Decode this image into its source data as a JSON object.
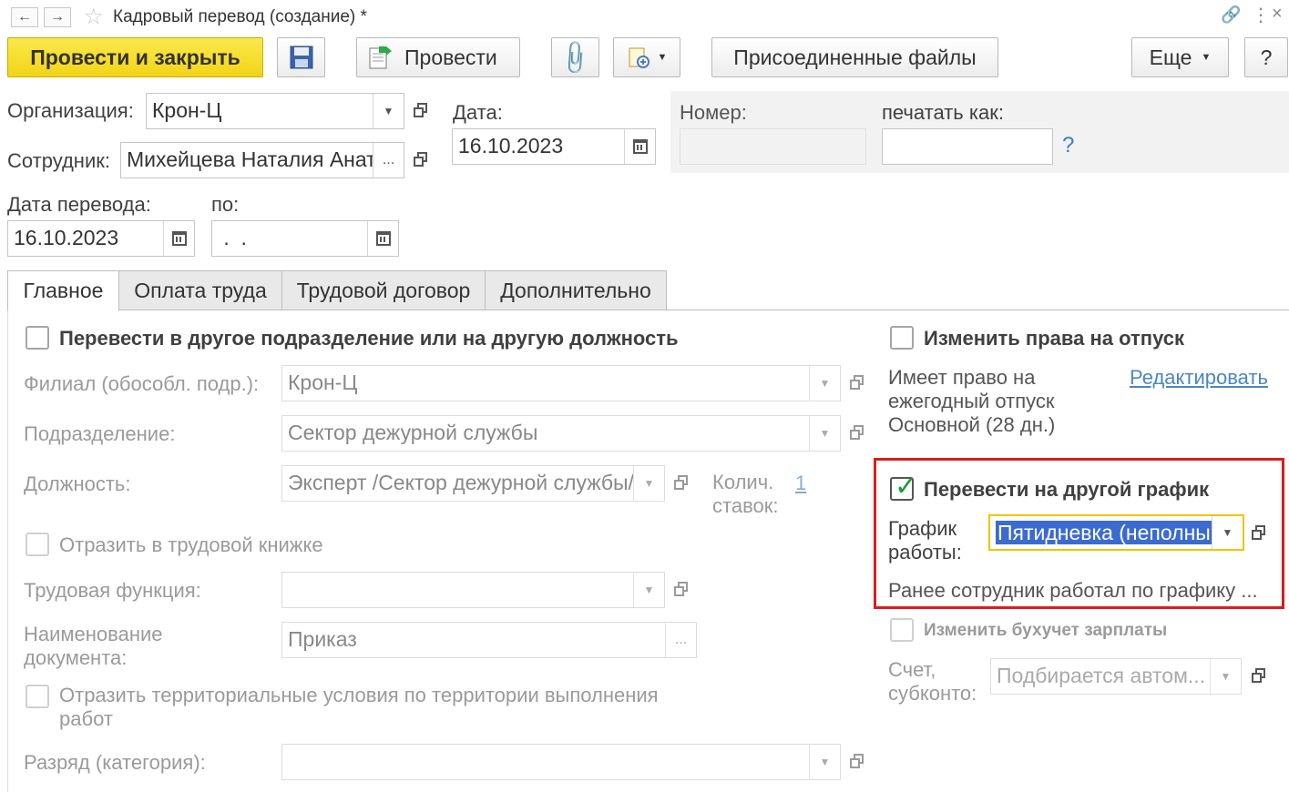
{
  "window": {
    "title": "Кадровый перевод (создание) *",
    "back": "←",
    "forward": "→"
  },
  "toolbar": {
    "post_close": "Провести и закрыть",
    "post": "Провести",
    "attached_files": "Присоединенные файлы",
    "more": "Еще",
    "help": "?"
  },
  "header": {
    "org_label": "Организация:",
    "org_value": "Крон-Ц",
    "employee_label": "Сотрудник:",
    "employee_value": "Михейцева Наталия Анат",
    "date_label": "Дата:",
    "date_value": "16.10.2023",
    "number_label": "Номер:",
    "number_value": "",
    "print_as_label": "печатать как:",
    "print_as_value": "",
    "help_q": "?",
    "transfer_date_label": "Дата перевода:",
    "transfer_date_value": "16.10.2023",
    "to_label": "по:",
    "to_value": " .  ."
  },
  "tabs": [
    {
      "label": "Главное"
    },
    {
      "label": "Оплата труда"
    },
    {
      "label": "Трудовой договор"
    },
    {
      "label": "Дополнительно"
    }
  ],
  "main": {
    "transfer_dept_label": "Перевести в другое подразделение или на другую должность",
    "branch_label": "Филиал (обособл. подр.):",
    "branch_value": "Крон-Ц",
    "dept_label": "Подразделение:",
    "dept_value": "Сектор дежурной службы",
    "position_label": "Должность:",
    "position_value": "Эксперт /Сектор дежурной службы/",
    "rates_label": "Колич. ставок:",
    "rates_value": "1",
    "workbook_label": "Отразить в трудовой книжке",
    "labor_func_label": "Трудовая функция:",
    "labor_func_value": "",
    "doc_name_label": "Наименование документа:",
    "doc_name_value": "Приказ",
    "territorial_label": "Отразить территориальные условия по территории выполнения работ",
    "grade_label": "Разряд (категория):",
    "grade_value": ""
  },
  "right": {
    "vacation_label": "Изменить права на отпуск",
    "vacation_info": "Имеет право на ежегодный отпуск Основной (28 дн.)",
    "edit_link": "Редактировать",
    "schedule_transfer_label": "Перевести на другой график",
    "schedule_label": "График работы:",
    "schedule_value": "Пятидневка (неполны",
    "prev_schedule": "Ранее сотрудник работал по графику ...",
    "accounting_label": "Изменить бухучет зарплаты",
    "account_label": "Счет, субконто:",
    "account_value": "Подбирается автом..."
  }
}
